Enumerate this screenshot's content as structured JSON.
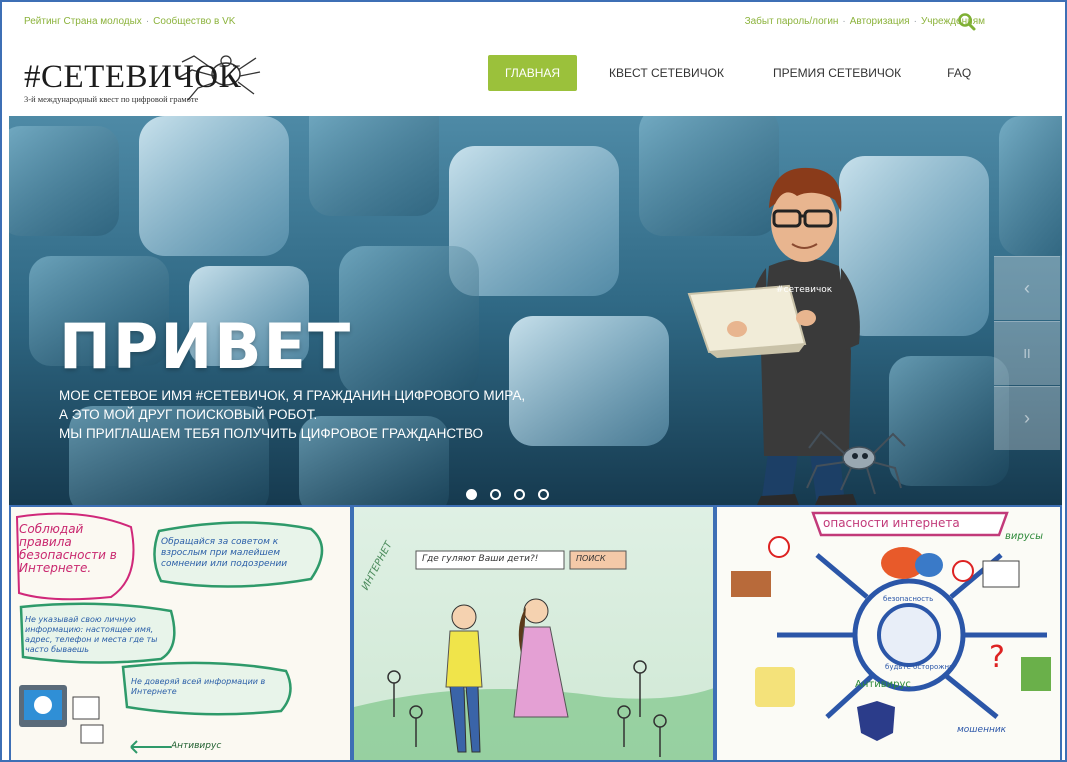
{
  "topbar": {
    "left_links": [
      "Рейтинг Страна молодых",
      "Сообщество в VK"
    ],
    "right_links": [
      "Забыт пароль/логин",
      "Авторизация",
      "Учреждениям"
    ],
    "separator": "·",
    "search_icon": "search-icon"
  },
  "logo": {
    "title": "#СЕТЕВИЧОК",
    "subtitle": "3-й международный квест по цифровой грамоте"
  },
  "nav": {
    "items": [
      {
        "label": "ГЛАВНАЯ",
        "active": true
      },
      {
        "label": "КВЕСТ СЕТЕВИЧОК",
        "active": false
      },
      {
        "label": "ПРЕМИЯ СЕТЕВИЧОК",
        "active": false
      },
      {
        "label": "FAQ",
        "active": false
      }
    ]
  },
  "hero": {
    "title": "ПРИВЕТ",
    "lines": [
      "МОЕ СЕТЕВОЕ ИМЯ #СЕТЕВИЧОК, Я ГРАЖДАНИН ЦИФРОВОГО МИРА,",
      "А ЭТО МОЙ ДРУГ ПОИСКОВЫЙ РОБОТ.",
      "МЫ ПРИГЛАШАЕМ ТЕБЯ ПОЛУЧИТЬ ЦИФРОВОЕ ГРАЖДАНСТВО"
    ],
    "shirt_text": "#сетевичок",
    "controls": {
      "prev": "‹",
      "pause": "II",
      "next": "›"
    },
    "dots": {
      "count": 4,
      "active_index": 0
    }
  },
  "gallery": {
    "card1": {
      "heading": "Соблюдай правила безопасности в Интернете.",
      "bubble1": "Обращайся за советом к взрослым при малейшем сомнении или подозрении",
      "bubble2": "Не указывай свою личную информацию: настоящее имя, адрес, телефон и места где ты часто бываешь",
      "bubble3": "Не доверяй всей информации в Интернете",
      "footer": "Антивирус"
    },
    "card2": {
      "search_text": "Где гуляют Ваши дети?!",
      "search_button": "ПОИСК",
      "side_text": "ИНТЕРНЕТ"
    },
    "card3": {
      "banner": "опасности интернета",
      "viruses": "вирусы",
      "center": "безопасность",
      "bottom1": "будьте осторожны",
      "antivirus": "Антивирус",
      "fraud": "мошенник"
    }
  },
  "colors": {
    "accent_green": "#9bc13b",
    "link_green": "#8cb33c",
    "frame_blue": "#3d6fb5",
    "hero_blue": "#2a5570"
  }
}
